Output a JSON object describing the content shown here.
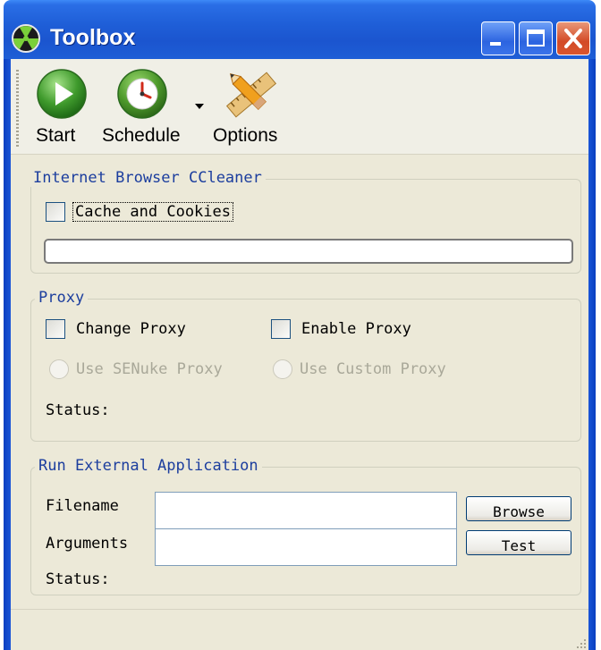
{
  "window": {
    "title": "Toolbox",
    "colors": {
      "titlebar": "#1f5fd8",
      "close": "#d34a26",
      "group_title": "#1c3e9e",
      "face": "#ece9d8"
    }
  },
  "toolbar": {
    "start_label": "Start",
    "schedule_label": "Schedule",
    "options_label": "Options",
    "icons": [
      "play-icon",
      "clock-icon",
      "dropdown-arrow-icon",
      "pencil-ruler-icon"
    ]
  },
  "browser_cleaner": {
    "title": "Internet Browser CCleaner",
    "cache_label": "Cache and Cookies",
    "cache_checked": false,
    "progress": 0
  },
  "proxy": {
    "title": "Proxy",
    "change_proxy_label": "Change Proxy",
    "enable_proxy_label": "Enable Proxy",
    "use_senuke_label": "Use SENuke Proxy",
    "use_custom_label": "Use Custom Proxy",
    "status_label": "Status:"
  },
  "external": {
    "title": "Run External Application",
    "filename_label": "Filename",
    "filename_value": "",
    "arguments_label": "Arguments",
    "arguments_value": "",
    "browse_label": "Browse",
    "test_label": "Test",
    "status_label": "Status:"
  }
}
